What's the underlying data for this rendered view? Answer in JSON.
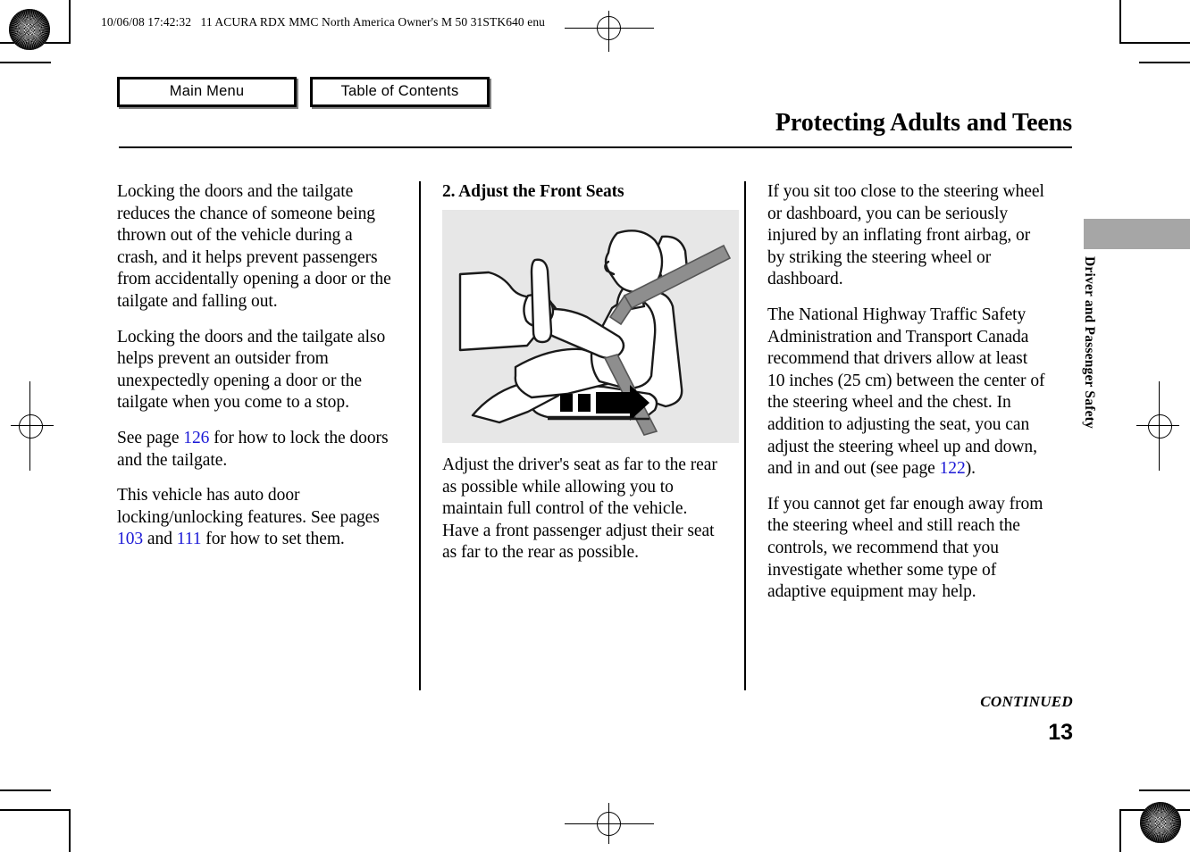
{
  "document": {
    "header_line": "10/06/08 17:42:32   11 ACURA RDX MMC North America Owner's M 50 31STK640 enu",
    "title": "Protecting Adults and Teens",
    "continued_label": "CONTINUED",
    "page_number": "13",
    "side_tab_label": "Driver and Passenger Safety"
  },
  "nav": {
    "main_menu": "Main Menu",
    "table_of_contents": "Table of Contents"
  },
  "colors": {
    "link": "#1b19d6",
    "figure_background": "#e7e7e7",
    "side_tab": "#a6a6a6",
    "text": "#000000",
    "page": "#ffffff"
  },
  "columns": {
    "left": {
      "paragraphs": [
        {
          "segments": [
            {
              "text": "Locking the doors and the tailgate reduces the chance of someone being thrown out of the vehicle during a crash, and it helps prevent passengers from accidentally opening a door or the tailgate and falling out.",
              "link": false
            }
          ]
        },
        {
          "segments": [
            {
              "text": "Locking the doors and the tailgate also helps prevent an outsider from unexpectedly opening a door or the tailgate when you come to a stop.",
              "link": false
            }
          ]
        },
        {
          "segments": [
            {
              "text": "See page ",
              "link": false
            },
            {
              "text": "126",
              "link": true
            },
            {
              "text": " for how to lock the doors and the tailgate.",
              "link": false
            }
          ]
        },
        {
          "segments": [
            {
              "text": "This vehicle has auto door locking/unlocking features. See pages ",
              "link": false
            },
            {
              "text": "103",
              "link": true
            },
            {
              "text": " and ",
              "link": false
            },
            {
              "text": "111",
              "link": true
            },
            {
              "text": " for how to set them.",
              "link": false
            }
          ]
        }
      ]
    },
    "middle": {
      "heading": "2. Adjust the Front Seats",
      "figure": {
        "name": "driver-seat-adjustment-illustration",
        "alt": "Side view of a seated driver wearing a seat belt and holding the steering wheel, with a dashed arrow indicating the seat sliding rearward"
      },
      "paragraphs": [
        {
          "segments": [
            {
              "text": "Adjust the driver's seat as far to the rear as possible while allowing you to maintain full control of the vehicle. Have a front passenger adjust their seat as far to the rear as possible.",
              "link": false
            }
          ]
        }
      ]
    },
    "right": {
      "paragraphs": [
        {
          "segments": [
            {
              "text": "If you sit too close to the steering wheel or dashboard, you can be seriously injured by an inflating front airbag, or by striking the steering wheel or dashboard.",
              "link": false
            }
          ]
        },
        {
          "segments": [
            {
              "text": "The National Highway Traffic Safety Administration and Transport Canada recommend that drivers allow at least 10 inches (25 cm) between the center of the steering wheel and the chest. In addition to adjusting the seat, you can adjust the steering wheel up and down, and in and out (see page ",
              "link": false
            },
            {
              "text": "122",
              "link": true
            },
            {
              "text": ").",
              "link": false
            }
          ]
        },
        {
          "segments": [
            {
              "text": "If you cannot get far enough away from the steering wheel and still reach the controls, we recommend that you investigate whether some type of adaptive equipment may help.",
              "link": false
            }
          ]
        }
      ]
    }
  }
}
